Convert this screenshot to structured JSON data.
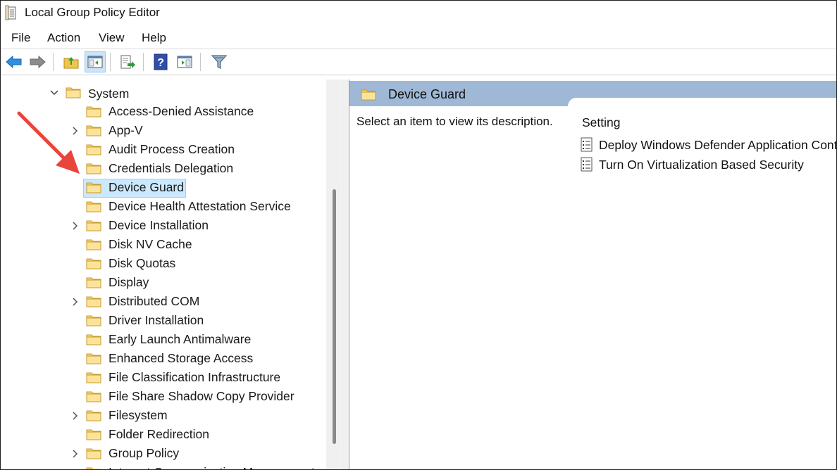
{
  "window": {
    "title": "Local Group Policy Editor"
  },
  "menu": [
    "File",
    "Action",
    "View",
    "Help"
  ],
  "toolbar": {
    "buttons": [
      "back-arrow-icon",
      "forward-arrow-icon",
      "folder-up-icon",
      "show-hide-tree-icon",
      "export-list-icon",
      "help-icon",
      "action-pane-icon",
      "filter-icon"
    ]
  },
  "tree": {
    "parent": "System",
    "items": [
      {
        "label": "Access-Denied Assistance",
        "expandable": false
      },
      {
        "label": "App-V",
        "expandable": true
      },
      {
        "label": "Audit Process Creation",
        "expandable": false
      },
      {
        "label": "Credentials Delegation",
        "expandable": false
      },
      {
        "label": "Device Guard",
        "expandable": false,
        "selected": true
      },
      {
        "label": "Device Health Attestation Service",
        "expandable": false
      },
      {
        "label": "Device Installation",
        "expandable": true
      },
      {
        "label": "Disk NV Cache",
        "expandable": false
      },
      {
        "label": "Disk Quotas",
        "expandable": false
      },
      {
        "label": "Display",
        "expandable": false
      },
      {
        "label": "Distributed COM",
        "expandable": true
      },
      {
        "label": "Driver Installation",
        "expandable": false
      },
      {
        "label": "Early Launch Antimalware",
        "expandable": false
      },
      {
        "label": "Enhanced Storage Access",
        "expandable": false
      },
      {
        "label": "File Classification Infrastructure",
        "expandable": false
      },
      {
        "label": "File Share Shadow Copy Provider",
        "expandable": false
      },
      {
        "label": "Filesystem",
        "expandable": true
      },
      {
        "label": "Folder Redirection",
        "expandable": false
      },
      {
        "label": "Group Policy",
        "expandable": true
      },
      {
        "label": "Internet Communication Management",
        "expandable": true
      }
    ]
  },
  "details": {
    "header": "Device Guard",
    "description": "Select an item to view its description.",
    "column_header": "Setting",
    "settings": [
      "Deploy Windows Defender Application Control",
      "Turn On Virtualization Based Security"
    ]
  },
  "colors": {
    "header_band": "#9fb8d6",
    "selection": "#cce8ff",
    "folder_fill": "#f8d775",
    "annotation_arrow": "#e8453c"
  }
}
